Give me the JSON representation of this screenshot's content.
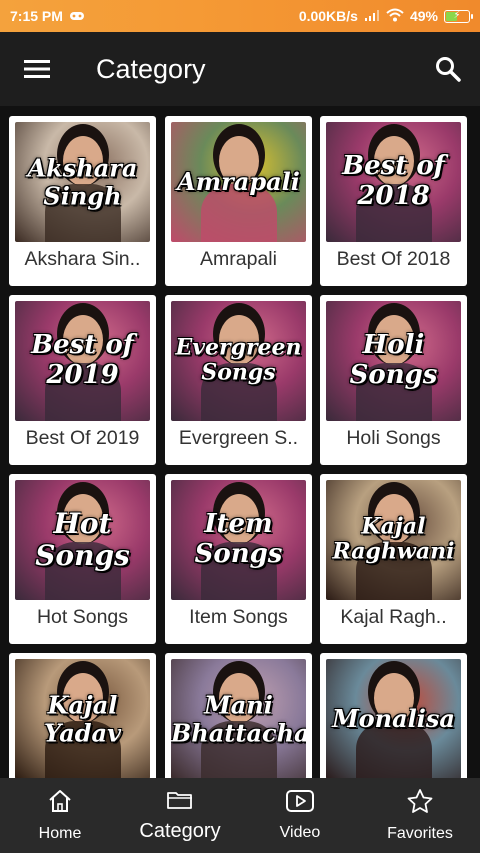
{
  "status_bar": {
    "time": "7:15 PM",
    "network_speed": "0.00KB/s",
    "battery": "49%",
    "battery_level": 0.49
  },
  "app_bar": {
    "menu_icon": "hamburger-menu-icon",
    "title": "Category",
    "search_icon": "search-icon"
  },
  "categories": [
    {
      "label": "Akshara Sin..",
      "overlay": "Akshara\nSingh"
    },
    {
      "label": "Amrapali",
      "overlay": "Amrapali"
    },
    {
      "label": "Best Of 2018",
      "overlay": "Best of\n2018"
    },
    {
      "label": "Best Of 2019",
      "overlay": "Best of\n2019"
    },
    {
      "label": "Evergreen S..",
      "overlay": "Evergreen\nSongs"
    },
    {
      "label": "Holi Songs",
      "overlay": "Holi\nSongs"
    },
    {
      "label": "Hot Songs",
      "overlay": "Hot\nSongs"
    },
    {
      "label": "Item Songs",
      "overlay": "Item\nSongs"
    },
    {
      "label": "Kajal Ragh..",
      "overlay": "Kajal\nRaghwani"
    },
    {
      "label": "",
      "overlay": "Kajal\nYadav"
    },
    {
      "label": "",
      "overlay": "Mani\nBhattacharya"
    },
    {
      "label": "",
      "overlay": "Monalisa"
    }
  ],
  "bottom_nav": [
    {
      "label": "Home",
      "icon": "home-icon",
      "active": false
    },
    {
      "label": "Category",
      "icon": "folder-icon",
      "active": true
    },
    {
      "label": "Video",
      "icon": "video-play-icon",
      "active": false
    },
    {
      "label": "Favorites",
      "icon": "star-icon",
      "active": false
    }
  ],
  "colors": {
    "status_bar": "#f59a35",
    "app_bar": "#1e1e1e",
    "background": "#111111",
    "card": "#ffffff",
    "bottom_nav": "#2a2a2a"
  }
}
